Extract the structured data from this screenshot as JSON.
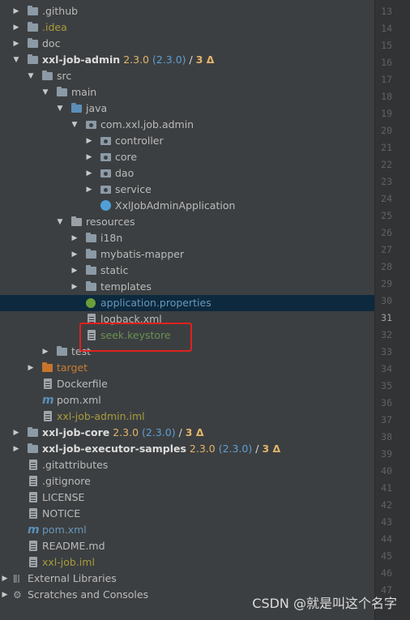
{
  "tree": {
    "rows": [
      {
        "label": ".github",
        "type": "folder"
      },
      {
        "label": ".idea",
        "type": "folder"
      },
      {
        "label": "doc",
        "type": "folder"
      },
      {
        "label": "xxl-job-admin",
        "version": "2.3.0",
        "version_paren": "(2.3.0)",
        "changes": "3 Δ"
      },
      {
        "label": "src"
      },
      {
        "label": "main"
      },
      {
        "label": "java"
      },
      {
        "label": "com.xxl.job.admin"
      },
      {
        "label": "controller"
      },
      {
        "label": "core"
      },
      {
        "label": "dao"
      },
      {
        "label": "service"
      },
      {
        "label": "XxlJobAdminApplication"
      },
      {
        "label": "resources"
      },
      {
        "label": "i18n"
      },
      {
        "label": "mybatis-mapper"
      },
      {
        "label": "static"
      },
      {
        "label": "templates"
      },
      {
        "label": "application.properties"
      },
      {
        "label": "logback.xml"
      },
      {
        "label": "seek.keystore"
      },
      {
        "label": "test"
      },
      {
        "label": "target"
      },
      {
        "label": "Dockerfile"
      },
      {
        "label": "pom.xml"
      },
      {
        "label": "xxl-job-admin.iml"
      },
      {
        "label": "xxl-job-core",
        "version": "2.3.0",
        "version_paren": "(2.3.0)",
        "changes": "3 Δ"
      },
      {
        "label": "xxl-job-executor-samples",
        "version": "2.3.0",
        "version_paren": "(2.3.0)",
        "changes": "3 Δ"
      },
      {
        "label": ".gitattributes"
      },
      {
        "label": ".gitignore"
      },
      {
        "label": "LICENSE"
      },
      {
        "label": "NOTICE"
      },
      {
        "label": "pom.xml"
      },
      {
        "label": "README.md"
      },
      {
        "label": "xxl-job.iml"
      },
      {
        "label": "External Libraries"
      },
      {
        "label": "Scratches and Consoles"
      }
    ],
    "slash": "/"
  },
  "gutter": {
    "lines": [
      "13",
      "14",
      "15",
      "16",
      "17",
      "18",
      "19",
      "20",
      "21",
      "22",
      "23",
      "24",
      "25",
      "26",
      "27",
      "28",
      "29",
      "30",
      "31",
      "32",
      "33",
      "34",
      "35",
      "36",
      "37",
      "38",
      "39",
      "40",
      "41",
      "42",
      "43",
      "44",
      "45",
      "46",
      "47"
    ]
  },
  "watermark": "CSDN @就是叫这个名字"
}
